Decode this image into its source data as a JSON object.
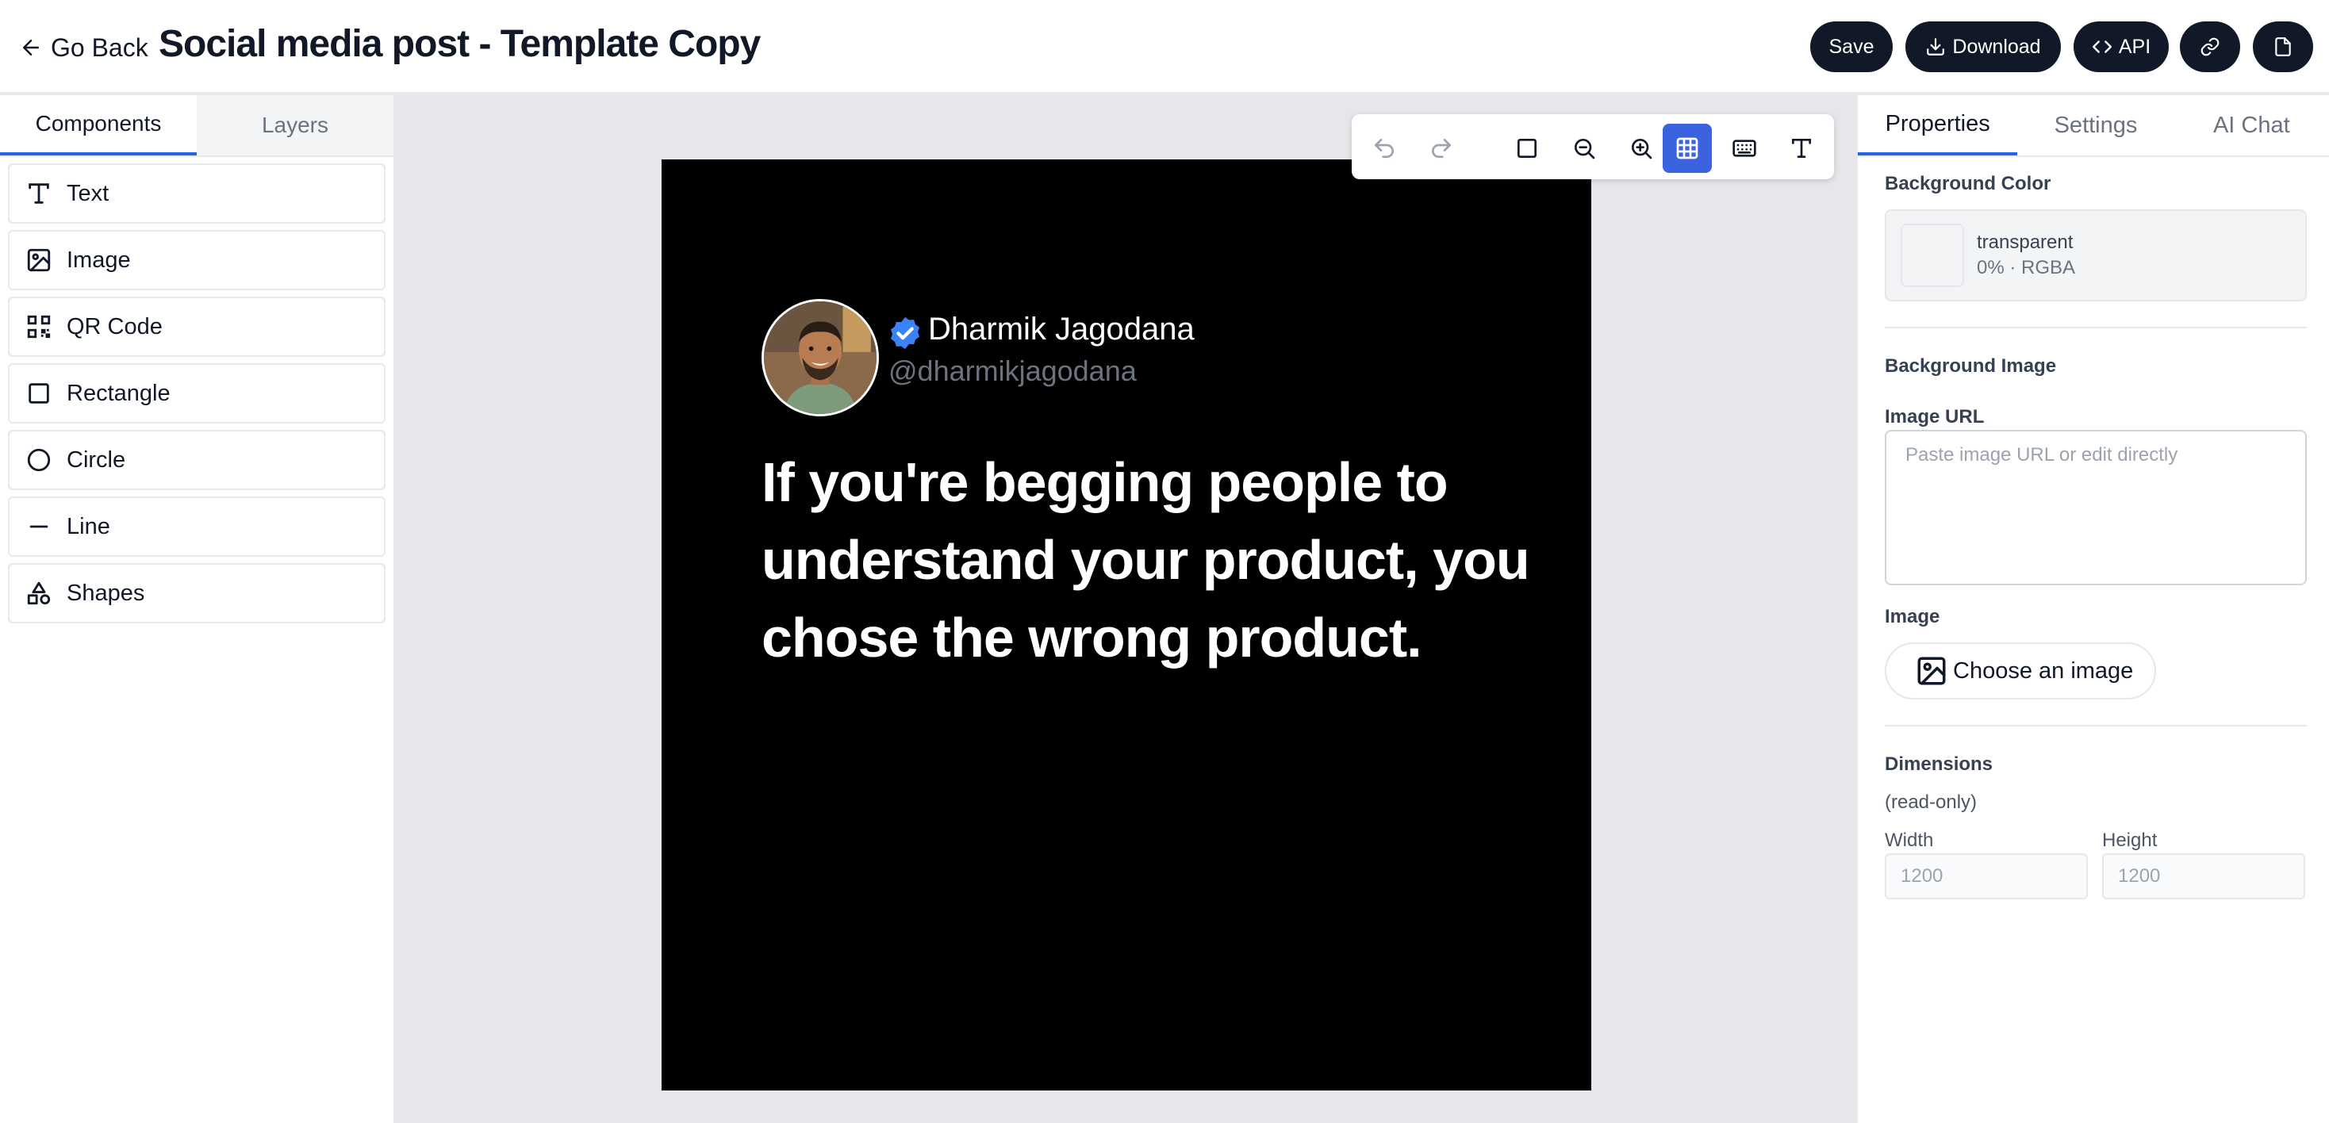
{
  "header": {
    "go_back_label": "Go Back",
    "title": "Social media post - Template Copy",
    "save_label": "Save",
    "download_label": "Download",
    "api_label": "API"
  },
  "left_sidebar": {
    "tabs": [
      {
        "label": "Components",
        "active": true
      },
      {
        "label": "Layers",
        "active": false
      }
    ],
    "components": [
      {
        "label": "Text",
        "icon": "text-icon"
      },
      {
        "label": "Image",
        "icon": "image-icon"
      },
      {
        "label": "QR Code",
        "icon": "qr-code-icon"
      },
      {
        "label": "Rectangle",
        "icon": "rectangle-icon"
      },
      {
        "label": "Circle",
        "icon": "circle-icon"
      },
      {
        "label": "Line",
        "icon": "line-icon"
      },
      {
        "label": "Shapes",
        "icon": "shapes-icon"
      }
    ]
  },
  "toolbar": {
    "tools": [
      "undo-icon",
      "redo-icon",
      "select-frame-icon",
      "zoom-out-icon",
      "zoom-in-icon",
      "grid-icon",
      "keyboard-icon",
      "text-tool-icon"
    ],
    "active_tool": "grid-icon"
  },
  "canvas": {
    "background": "#000000",
    "post": {
      "author_name": "Dharmik Jagodana",
      "author_handle": "@dharmikjagodana",
      "quote": "If you're begging people to understand your product, you chose the wrong product."
    }
  },
  "right_sidebar": {
    "tabs": [
      {
        "label": "Properties",
        "active": true
      },
      {
        "label": "Settings",
        "active": false
      },
      {
        "label": "AI Chat",
        "active": false
      }
    ],
    "background_color_label": "Background Color",
    "color_value": "transparent",
    "color_meta": "0% · RGBA",
    "background_image_label": "Background Image",
    "image_url_label": "Image URL",
    "image_url_placeholder": "Paste image URL or edit directly",
    "image_label": "Image",
    "choose_image_label": "Choose an image",
    "dimensions_label": "Dimensions",
    "dimensions_note": "(read-only)",
    "width_label": "Width",
    "width_value": "1200",
    "height_label": "Height",
    "height_value": "1200"
  },
  "colors": {
    "accent": "#2563eb",
    "dark_button": "#111827",
    "verified": "#3b82f6"
  }
}
